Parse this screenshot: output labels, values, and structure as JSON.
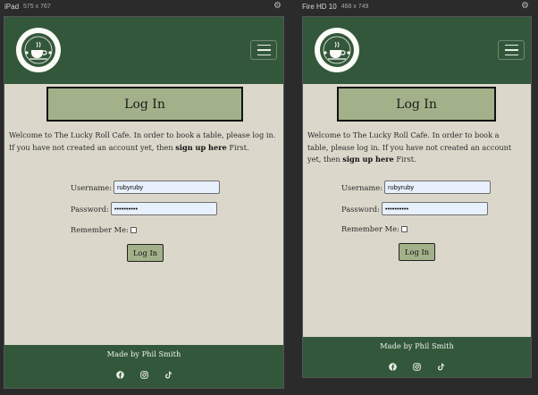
{
  "devices": [
    {
      "name": "iPad",
      "dims": "575 x 767",
      "page": {
        "title": "Log In",
        "intro_before": "Welcome to The Lucky Roll Cafe. In order to book a table, please log in. If you have not created an account yet, then ",
        "intro_link": "sign up here",
        "intro_after": " First.",
        "username_label": "Username:",
        "username_value": "rubyruby",
        "password_label": "Password:",
        "password_value": "••••••••••",
        "remember_label": "Remember Me:",
        "login_button": "Log In",
        "footer_text": "Made by Phil Smith"
      }
    },
    {
      "name": "Fire HD 10",
      "dims": "468 x 749",
      "page": {
        "title": "Log In",
        "intro_before": "Welcome to The Lucky Roll Cafe. In order to book a table, please log in. If you have not created an account yet, then ",
        "intro_link": "sign up here",
        "intro_after": " First.",
        "username_label": "Username:",
        "username_value": "rubyruby",
        "password_label": "Password:",
        "password_value": "••••••••••",
        "remember_label": "Remember Me:",
        "login_button": "Log In",
        "footer_text": "Made by Phil Smith"
      }
    }
  ],
  "colors": {
    "navbar": "#33573a",
    "page_background": "#dbd8cb",
    "accent_button": "#a3b18a",
    "input_fill": "#e8f0fe"
  },
  "icons": {
    "settings": "gear-icon",
    "menu": "hamburger-icon",
    "logo": "cafe-cup-logo",
    "socials": [
      "facebook-icon",
      "instagram-icon",
      "tiktok-icon"
    ]
  }
}
